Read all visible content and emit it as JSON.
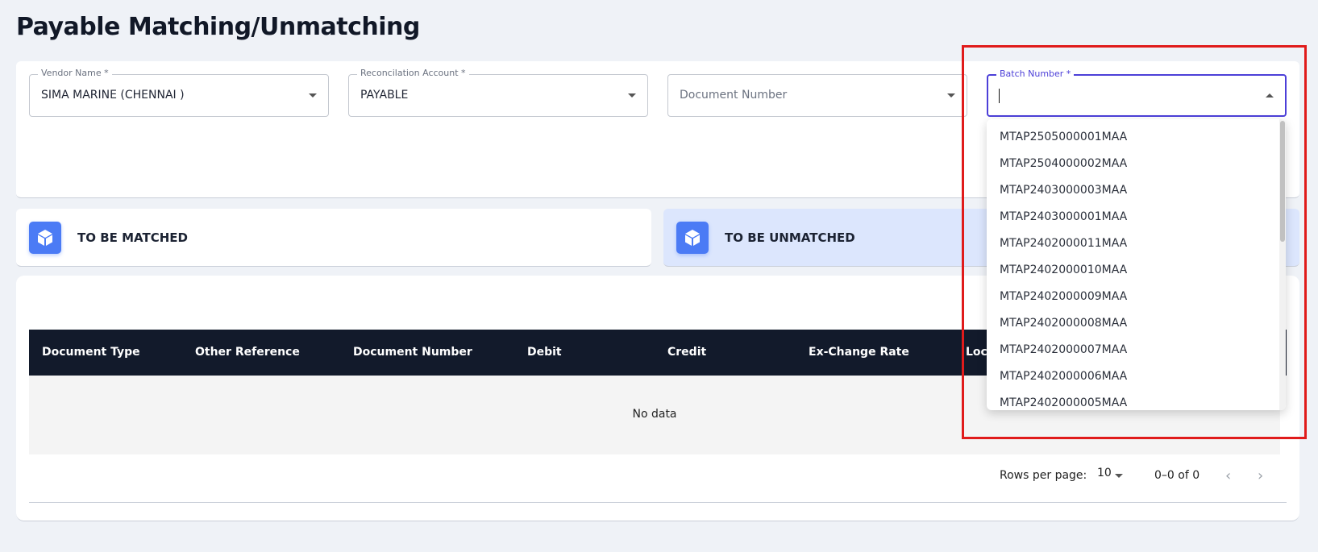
{
  "page": {
    "title": "Payable Matching/Unmatching"
  },
  "filters": {
    "vendor": {
      "label": "Vendor Name *",
      "value": "SIMA MARINE (CHENNAI )"
    },
    "account": {
      "label": "Reconcilation Account *",
      "value": "PAYABLE"
    },
    "document": {
      "placeholder": "Document Number"
    },
    "batch": {
      "label": "Batch Number *",
      "value": ""
    }
  },
  "tabs": [
    {
      "label": "TO BE MATCHED",
      "active": false
    },
    {
      "label": "TO BE UNMATCHED",
      "active": true
    }
  ],
  "table": {
    "columns": [
      "Document Type",
      "Other Reference",
      "Document Number",
      "Debit",
      "Credit",
      "Ex-Change Rate",
      "Loca"
    ],
    "empty_text": "No data"
  },
  "pagination": {
    "rows_label": "Rows per page:",
    "rows_value": "10",
    "range": "0–0 of 0"
  },
  "dropdown": {
    "options": [
      "MTAP2505000001MAA",
      "MTAP2504000002MAA",
      "MTAP2403000003MAA",
      "MTAP2403000001MAA",
      "MTAP2402000011MAA",
      "MTAP2402000010MAA",
      "MTAP2402000009MAA",
      "MTAP2402000008MAA",
      "MTAP2402000007MAA",
      "MTAP2402000006MAA",
      "MTAP2402000005MAA"
    ]
  },
  "colors": {
    "accent": "#4c3fd8",
    "tab_icon": "#4b7bf5",
    "table_header": "#121a2b",
    "active_tab_bg": "#dce6fd",
    "highlight": "#e01b1b"
  }
}
